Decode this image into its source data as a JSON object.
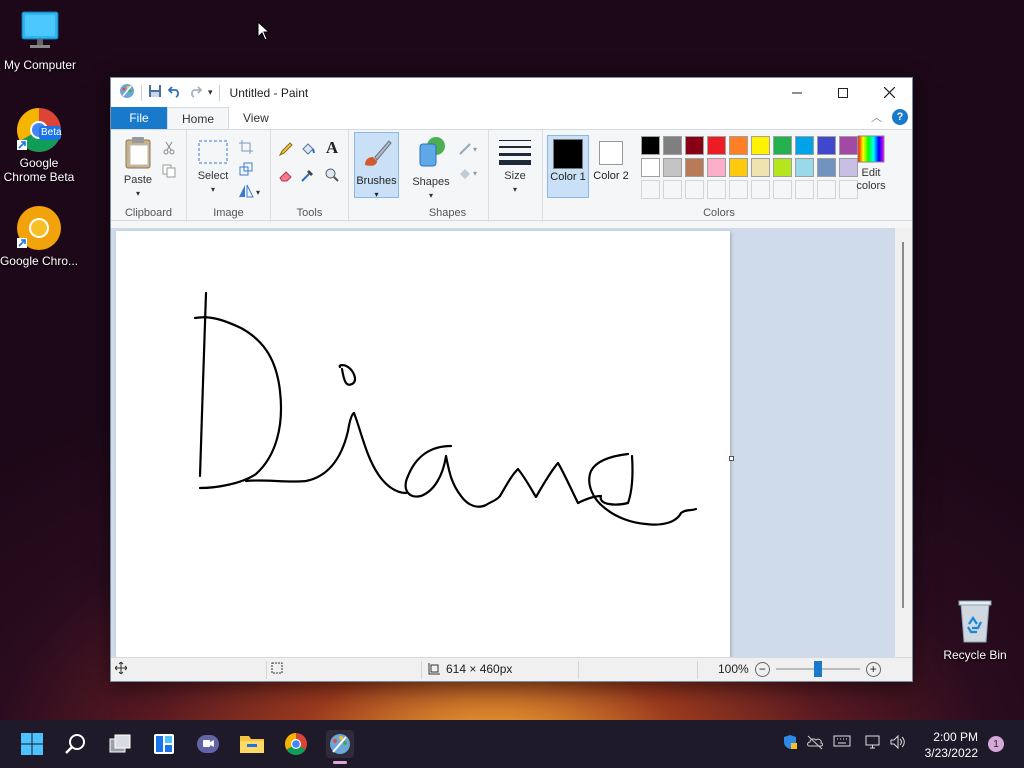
{
  "desktop": {
    "icons": [
      {
        "label": "My Computer"
      },
      {
        "label": "Google Chrome Beta",
        "badge": "Beta"
      },
      {
        "label": "Google Chro..."
      },
      {
        "label": "Recycle Bin"
      }
    ]
  },
  "window": {
    "title": "Untitled - Paint",
    "tabs": [
      {
        "label": "File"
      },
      {
        "label": "Home"
      },
      {
        "label": "View"
      }
    ]
  },
  "ribbon": {
    "clipboard": {
      "label": "Clipboard",
      "paste": "Paste"
    },
    "image": {
      "label": "Image",
      "select": "Select"
    },
    "tools": {
      "label": "Tools",
      "text_glyph": "A"
    },
    "brushes": {
      "label": "Brushes"
    },
    "shapes": {
      "label": "Shapes",
      "shapes_btn": "Shapes"
    },
    "size": {
      "label": "Size"
    },
    "colors": {
      "label": "Colors",
      "color1": "Color 1",
      "color2": "Color 2",
      "edit": "Edit colors",
      "color1_value": "#000000",
      "color2_value": "#ffffff",
      "palette_row1": [
        "#000000",
        "#7f7f7f",
        "#880015",
        "#ed1c24",
        "#ff7f27",
        "#fff200",
        "#22b14c",
        "#00a2e8",
        "#3f48cc",
        "#a349a4"
      ],
      "palette_row2": [
        "#ffffff",
        "#c3c3c3",
        "#b97a57",
        "#ffaec9",
        "#ffc90e",
        "#efe4b0",
        "#b5e61d",
        "#99d9ea",
        "#7092be",
        "#c8bfe7"
      ]
    }
  },
  "status": {
    "canvas_size": "614 × 460px",
    "zoom": "100%"
  },
  "taskbar": {
    "time": "2:00 PM",
    "date": "3/23/2022",
    "notifications": "1"
  }
}
